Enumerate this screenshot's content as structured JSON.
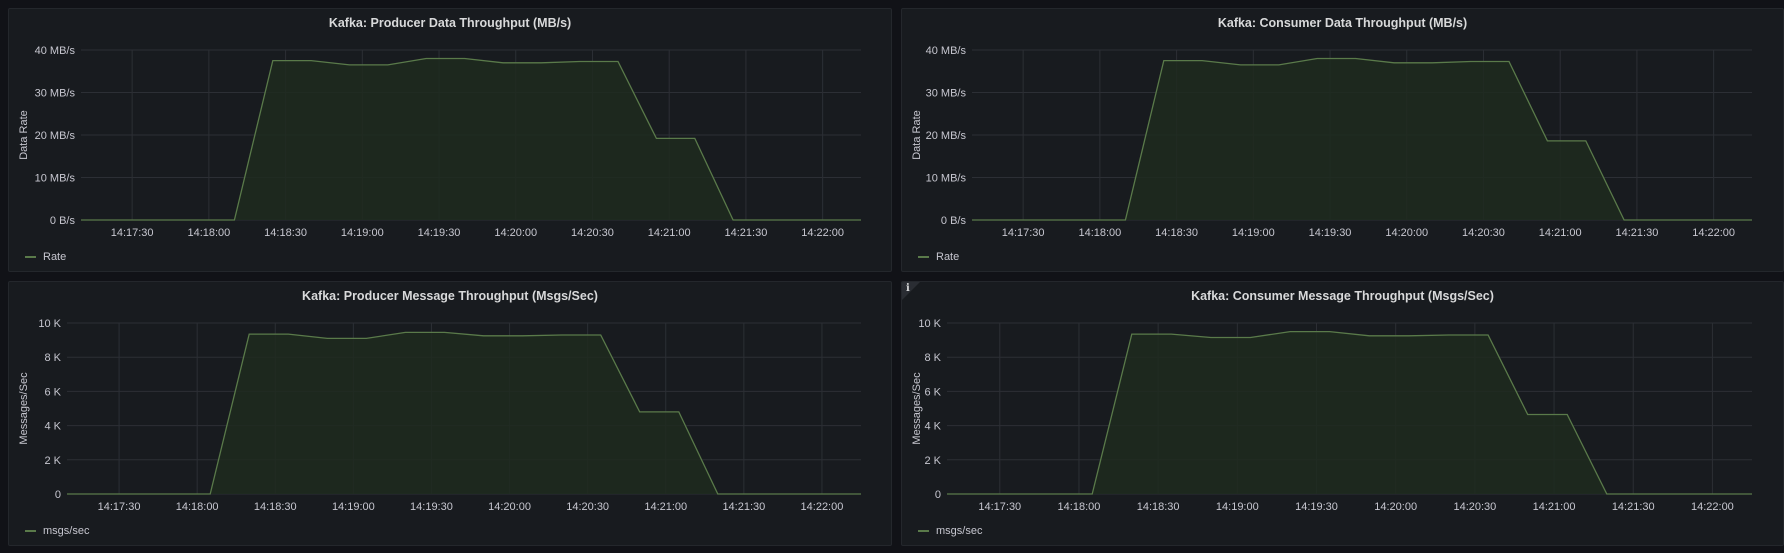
{
  "dashboard": {
    "panels": [
      {
        "title": "Kafka: Producer Data Throughput (MB/s)",
        "legend": "Rate",
        "info": false
      },
      {
        "title": "Kafka: Consumer Data Throughput (MB/s)",
        "legend": "Rate",
        "info": false
      },
      {
        "title": "Kafka: Producer Message Throughput (Msgs/Sec)",
        "legend": "msgs/sec",
        "info": false
      },
      {
        "title": "Kafka: Consumer Message Throughput (Msgs/Sec)",
        "legend": "msgs/sec",
        "info": true,
        "info_glyph": "i",
        "info_icon": "info-icon"
      }
    ]
  },
  "colors": {
    "series_line": "#5a7a4a",
    "series_fill": "#1f2a1f",
    "grid": "#2c2f35",
    "axis_text": "#c7c7d0",
    "panel_bg": "#181b1f"
  },
  "chart_data": [
    {
      "type": "area",
      "title": "Kafka: Producer Data Throughput (MB/s)",
      "ylabel": "Data Rate",
      "ylim": [
        0,
        40
      ],
      "yticks": [
        0,
        10,
        20,
        30,
        40
      ],
      "ytick_labels": [
        "0 B/s",
        "10 MB/s",
        "20 MB/s",
        "30 MB/s",
        "40 MB/s"
      ],
      "xlim": [
        "14:17:10",
        "14:22:15"
      ],
      "xticks": [
        "14:17:30",
        "14:18:00",
        "14:18:30",
        "14:19:00",
        "14:19:30",
        "14:20:00",
        "14:20:30",
        "14:21:00",
        "14:21:30",
        "14:22:00"
      ],
      "x": [
        "14:17:10",
        "14:18:10",
        "14:18:25",
        "14:18:40",
        "14:18:55",
        "14:19:10",
        "14:19:25",
        "14:19:40",
        "14:19:55",
        "14:20:10",
        "14:20:25",
        "14:20:40",
        "14:20:55",
        "14:21:10",
        "14:21:25",
        "14:22:15"
      ],
      "series": [
        {
          "name": "Rate",
          "values": [
            0,
            0,
            37.5,
            37.5,
            36.5,
            36.5,
            38,
            38,
            37,
            37,
            37.3,
            37.3,
            19.2,
            19.2,
            0,
            0
          ]
        }
      ]
    },
    {
      "type": "area",
      "title": "Kafka: Consumer Data Throughput (MB/s)",
      "ylabel": "Data Rate",
      "ylim": [
        0,
        40
      ],
      "yticks": [
        0,
        10,
        20,
        30,
        40
      ],
      "ytick_labels": [
        "0 B/s",
        "10 MB/s",
        "20 MB/s",
        "30 MB/s",
        "40 MB/s"
      ],
      "xlim": [
        "14:17:10",
        "14:22:15"
      ],
      "xticks": [
        "14:17:30",
        "14:18:00",
        "14:18:30",
        "14:19:00",
        "14:19:30",
        "14:20:00",
        "14:20:30",
        "14:21:00",
        "14:21:30",
        "14:22:00"
      ],
      "x": [
        "14:17:10",
        "14:18:10",
        "14:18:25",
        "14:18:40",
        "14:18:55",
        "14:19:10",
        "14:19:25",
        "14:19:40",
        "14:19:55",
        "14:20:10",
        "14:20:25",
        "14:20:40",
        "14:20:55",
        "14:21:10",
        "14:21:25",
        "14:22:15"
      ],
      "series": [
        {
          "name": "Rate",
          "values": [
            0,
            0,
            37.5,
            37.5,
            36.5,
            36.5,
            38,
            38,
            37,
            37,
            37.3,
            37.3,
            18.6,
            18.6,
            0,
            0
          ]
        }
      ]
    },
    {
      "type": "area",
      "title": "Kafka: Producer Message Throughput (Msgs/Sec)",
      "ylabel": "Messages/Sec",
      "ylim": [
        0,
        10000
      ],
      "yticks": [
        0,
        2000,
        4000,
        6000,
        8000,
        10000
      ],
      "ytick_labels": [
        "0",
        "2 K",
        "4 K",
        "6 K",
        "8 K",
        "10 K"
      ],
      "xlim": [
        "14:17:10",
        "14:22:15"
      ],
      "xticks": [
        "14:17:30",
        "14:18:00",
        "14:18:30",
        "14:19:00",
        "14:19:30",
        "14:20:00",
        "14:20:30",
        "14:21:00",
        "14:21:30",
        "14:22:00"
      ],
      "x": [
        "14:17:10",
        "14:18:05",
        "14:18:20",
        "14:18:35",
        "14:18:50",
        "14:19:05",
        "14:19:20",
        "14:19:35",
        "14:19:50",
        "14:20:05",
        "14:20:20",
        "14:20:35",
        "14:20:50",
        "14:21:05",
        "14:21:20",
        "14:22:15"
      ],
      "series": [
        {
          "name": "msgs/sec",
          "values": [
            0,
            0,
            9350,
            9350,
            9100,
            9100,
            9450,
            9450,
            9250,
            9250,
            9300,
            9300,
            4800,
            4800,
            0,
            0
          ]
        }
      ]
    },
    {
      "type": "area",
      "title": "Kafka: Consumer Message Throughput (Msgs/Sec)",
      "ylabel": "Messages/Sec",
      "ylim": [
        0,
        10000
      ],
      "yticks": [
        0,
        2000,
        4000,
        6000,
        8000,
        10000
      ],
      "ytick_labels": [
        "0",
        "2 K",
        "4 K",
        "6 K",
        "8 K",
        "10 K"
      ],
      "xlim": [
        "14:17:10",
        "14:22:15"
      ],
      "xticks": [
        "14:17:30",
        "14:18:00",
        "14:18:30",
        "14:19:00",
        "14:19:30",
        "14:20:00",
        "14:20:30",
        "14:21:00",
        "14:21:30",
        "14:22:00"
      ],
      "x": [
        "14:17:10",
        "14:18:05",
        "14:18:20",
        "14:18:35",
        "14:18:50",
        "14:19:05",
        "14:19:20",
        "14:19:35",
        "14:19:50",
        "14:20:05",
        "14:20:20",
        "14:20:35",
        "14:20:50",
        "14:21:05",
        "14:21:20",
        "14:22:15"
      ],
      "series": [
        {
          "name": "msgs/sec",
          "values": [
            0,
            0,
            9350,
            9350,
            9150,
            9150,
            9500,
            9500,
            9250,
            9250,
            9300,
            9300,
            4650,
            4650,
            0,
            0
          ]
        }
      ]
    }
  ]
}
